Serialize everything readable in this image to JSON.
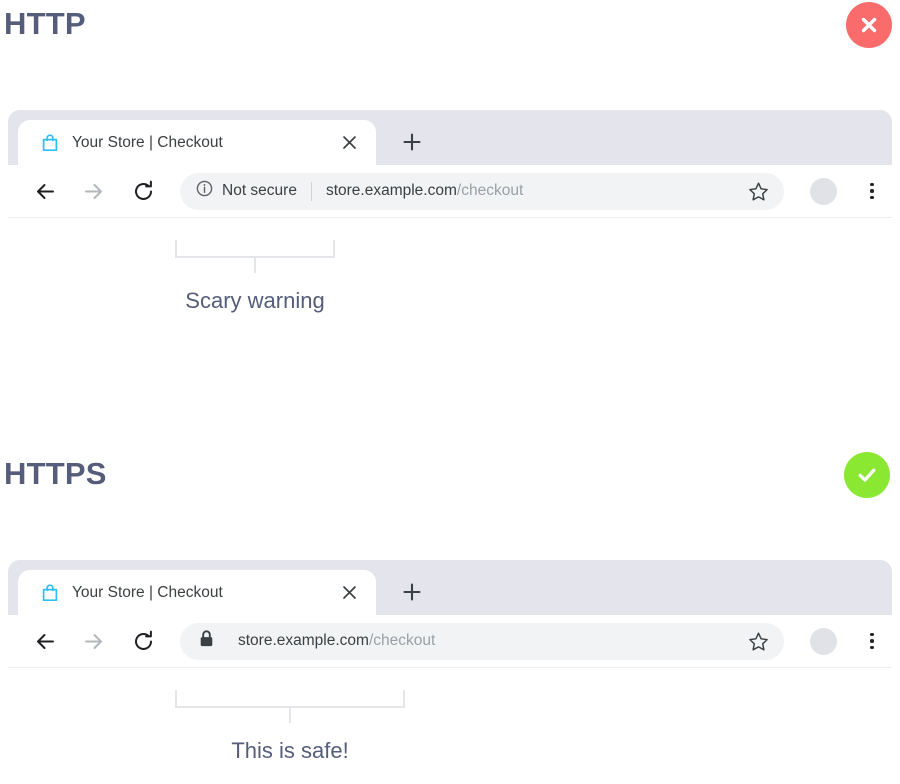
{
  "sections": [
    {
      "id": "http",
      "title": "HTTP",
      "badge": {
        "name": "error-badge",
        "icon": "close-icon",
        "color": "#fa6b6b"
      },
      "browser": {
        "tab": {
          "favicon": "shopping-bag-icon",
          "favicon_color": "#2bc0f5",
          "title": "Your Store | Checkout",
          "close_label": "×"
        },
        "new_tab_label": "+",
        "toolbar": {
          "back_icon": "arrow-left-icon",
          "forward_icon": "arrow-right-icon",
          "reload_icon": "reload-icon",
          "security_icon": "info-circle-icon",
          "security_label": "Not secure",
          "url_host": "store.example.com",
          "url_path": "/checkout",
          "bookmark_icon": "star-outline-icon",
          "avatar_icon": "avatar",
          "menu_icon": "kebab-menu-icon"
        }
      },
      "callout": {
        "caption": "Scary warning"
      }
    },
    {
      "id": "https",
      "title": "HTTPS",
      "badge": {
        "name": "success-badge",
        "icon": "check-icon",
        "color": "#8ae832"
      },
      "browser": {
        "tab": {
          "favicon": "shopping-bag-icon",
          "favicon_color": "#2bc0f5",
          "title": "Your Store | Checkout",
          "close_label": "×"
        },
        "new_tab_label": "+",
        "toolbar": {
          "back_icon": "arrow-left-icon",
          "forward_icon": "arrow-right-icon",
          "reload_icon": "reload-icon",
          "security_icon": "lock-closed-icon",
          "security_label": "",
          "url_host": "store.example.com",
          "url_path": "/checkout",
          "bookmark_icon": "star-outline-icon",
          "avatar_icon": "avatar",
          "menu_icon": "kebab-menu-icon"
        }
      },
      "callout": {
        "caption": "This is safe!"
      }
    }
  ],
  "colors": {
    "heading": "#555d7a",
    "caption": "#555d7a",
    "tabstrip": "#e3e4ec",
    "omnibox": "#f1f3f4",
    "url_host": "#3c4043",
    "url_path": "#9aa0a6",
    "bracket": "#e4e5e9"
  }
}
